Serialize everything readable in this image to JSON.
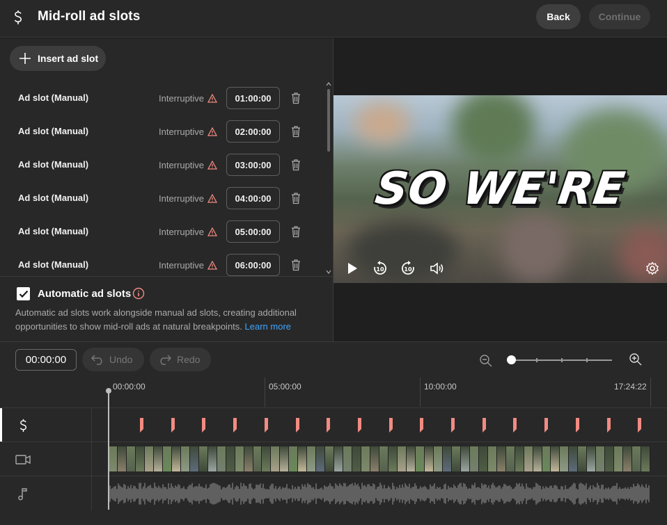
{
  "header": {
    "icon": "dollar-icon",
    "title": "Mid-roll ad slots",
    "back_label": "Back",
    "continue_label": "Continue"
  },
  "slots_panel": {
    "insert_label": "Insert ad slot",
    "insert_icon": "plus-icon",
    "slots": [
      {
        "name": "Ad slot (Manual)",
        "type": "Interruptive",
        "time": "01:00:00"
      },
      {
        "name": "Ad slot (Manual)",
        "type": "Interruptive",
        "time": "02:00:00"
      },
      {
        "name": "Ad slot (Manual)",
        "type": "Interruptive",
        "time": "03:00:00"
      },
      {
        "name": "Ad slot (Manual)",
        "type": "Interruptive",
        "time": "04:00:00"
      },
      {
        "name": "Ad slot (Manual)",
        "type": "Interruptive",
        "time": "05:00:00"
      },
      {
        "name": "Ad slot (Manual)",
        "type": "Interruptive",
        "time": "06:00:00"
      }
    ]
  },
  "automatic": {
    "checked": true,
    "label": "Automatic ad slots",
    "description": "Automatic ad slots work alongside manual ad slots, creating additional opportunities to show mid-roll ads at natural breakpoints.",
    "learn_more": "Learn more"
  },
  "preview": {
    "caption": "SO WE'RE",
    "controls": [
      "play-icon",
      "rewind-10-icon",
      "forward-10-icon",
      "volume-icon",
      "settings-icon"
    ]
  },
  "toolbar": {
    "timecode": "00:00:00",
    "undo_label": "Undo",
    "redo_label": "Redo"
  },
  "timeline": {
    "ruler_labels": [
      "00:00:00",
      "05:00:00",
      "10:00:00",
      "17:24:22"
    ],
    "tracks": [
      "dollar-icon",
      "video-icon",
      "music-note-icon"
    ],
    "ad_marker_count": 17
  },
  "colors": {
    "ad_marker": "#f28b82",
    "warning": "#f28b82",
    "link": "#3ea6ff",
    "background": "#282828"
  }
}
